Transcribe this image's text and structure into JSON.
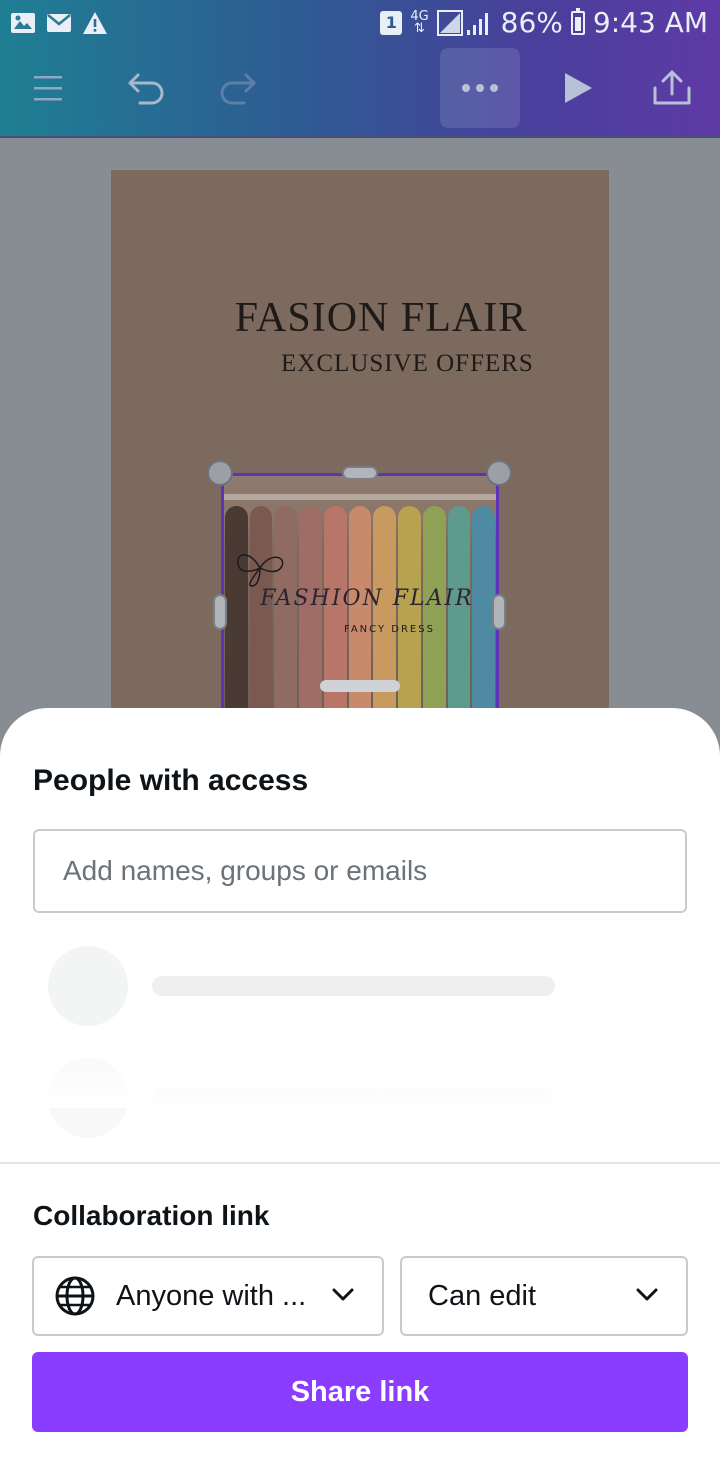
{
  "status_bar": {
    "sim": "1",
    "network": "4G",
    "battery": "86%",
    "time": "9:43 AM"
  },
  "toolbar": {
    "icons": [
      "menu-icon",
      "undo-icon",
      "redo-icon",
      "more-icon",
      "play-icon",
      "share-upload-icon"
    ]
  },
  "design": {
    "title": "FASION FLAIR",
    "subtitle": "EXCLUSIVE OFFERS",
    "photo_logo": "FASHION FLAIR",
    "photo_tag": "FANCY DRESS"
  },
  "sheet": {
    "title": "People with access",
    "search_placeholder": "Add names, groups or emails",
    "collab_title": "Collaboration link",
    "access_option": "Anyone with ...",
    "permission_option": "Can edit",
    "share_button": "Share link"
  },
  "colors": {
    "accent": "#8b3dff",
    "selection": "#5b34b8"
  }
}
